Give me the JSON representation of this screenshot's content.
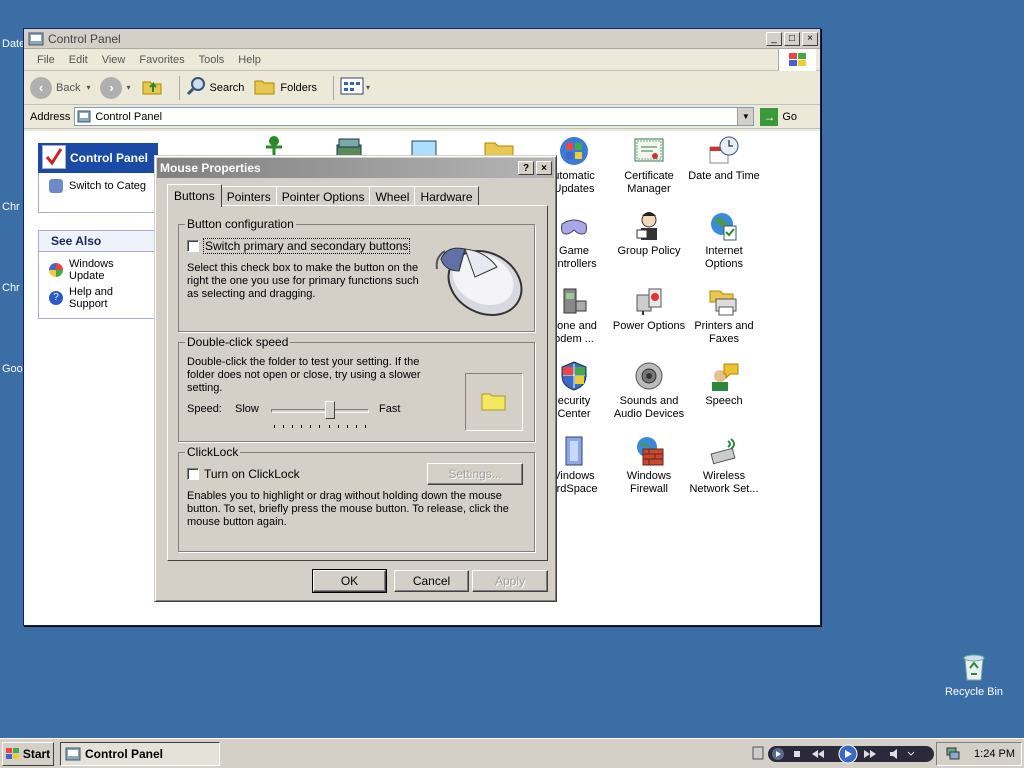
{
  "desktop": {
    "fragments": [
      "Date",
      "Chr",
      "Chr",
      "Goo"
    ],
    "recycle_bin": "Recycle Bin"
  },
  "window": {
    "title": "Control Panel",
    "menu": [
      "File",
      "Edit",
      "View",
      "Favorites",
      "Tools",
      "Help"
    ],
    "toolbar": {
      "back": "Back",
      "search": "Search",
      "folders": "Folders"
    },
    "address": {
      "label": "Address",
      "value": "Control Panel",
      "go": "Go"
    }
  },
  "leftpane": {
    "title": "Control Panel",
    "switch_link": "Switch to Categ",
    "see_also": "See Also",
    "links": [
      "Windows Update",
      "Help and Support"
    ]
  },
  "icons": [
    {
      "label": "Automatic Updates",
      "name": "automatic-updates-icon",
      "line1": "utomatic",
      "line2": "Updates"
    },
    {
      "label": "Certificate Manager",
      "name": "certificate-manager-icon",
      "line1": "Certificate",
      "line2": "Manager"
    },
    {
      "label": "Date and Time",
      "name": "date-and-time-icon",
      "line1": "Date and Time",
      "line2": ""
    },
    {
      "label": "Game Controllers",
      "name": "game-controllers-icon",
      "line1": "Game",
      "line2": "ontrollers"
    },
    {
      "label": "Group Policy",
      "name": "group-policy-icon",
      "line1": "Group Policy",
      "line2": ""
    },
    {
      "label": "Internet Options",
      "name": "internet-options-icon",
      "line1": "Internet",
      "line2": "Options"
    },
    {
      "label": "Phone and Modem",
      "name": "phone-and-modem-icon",
      "line1": "hone and",
      "line2": "odem ..."
    },
    {
      "label": "Power Options",
      "name": "power-options-icon",
      "line1": "Power Options",
      "line2": ""
    },
    {
      "label": "Printers and Faxes",
      "name": "printers-and-faxes-icon",
      "line1": "Printers and",
      "line2": "Faxes"
    },
    {
      "label": "Security Center",
      "name": "security-center-icon",
      "line1": "ecurity",
      "line2": "Center"
    },
    {
      "label": "Sounds and Audio Devices",
      "name": "sounds-and-audio-icon",
      "line1": "Sounds and",
      "line2": "Audio Devices"
    },
    {
      "label": "Speech",
      "name": "speech-icon",
      "line1": "Speech",
      "line2": ""
    },
    {
      "label": "Windows CardSpace",
      "name": "windows-cardspace-icon",
      "line1": "Vindows",
      "line2": "ardSpace"
    },
    {
      "label": "Windows Firewall",
      "name": "windows-firewall-icon",
      "line1": "Windows",
      "line2": "Firewall"
    },
    {
      "label": "Wireless Network Set...",
      "name": "wireless-network-icon",
      "line1": "Wireless",
      "line2": "Network Set..."
    }
  ],
  "dialog": {
    "title": "Mouse Properties",
    "help": "?",
    "close": "×",
    "tabs": [
      "Buttons",
      "Pointers",
      "Pointer Options",
      "Wheel",
      "Hardware"
    ],
    "active_tab": "Buttons",
    "button_config": {
      "legend": "Button configuration",
      "checkbox": "Switch primary and secondary buttons",
      "checked": false,
      "desc_lines": [
        "Select this check box to make the button on the",
        "right the one you use for primary functions such",
        "as selecting and dragging."
      ]
    },
    "double_click": {
      "legend": "Double-click speed",
      "desc_lines": [
        "Double-click the folder to test your setting. If the",
        "folder does not open or close, try using a slower",
        "setting."
      ],
      "speed_label": "Speed:",
      "slow": "Slow",
      "fast": "Fast",
      "slider_value": 0.6
    },
    "clicklock": {
      "legend": "ClickLock",
      "checkbox": "Turn on ClickLock",
      "checked": false,
      "settings": "Settings...",
      "desc_lines": [
        "Enables you to highlight or drag without holding down the mouse",
        "button. To set, briefly press the mouse button. To release, click the",
        "mouse button again."
      ]
    },
    "buttons": {
      "ok": "OK",
      "cancel": "Cancel",
      "apply": "Apply"
    }
  },
  "taskbar": {
    "start": "Start",
    "task": "Control Panel",
    "clock": "1:24 PM"
  }
}
